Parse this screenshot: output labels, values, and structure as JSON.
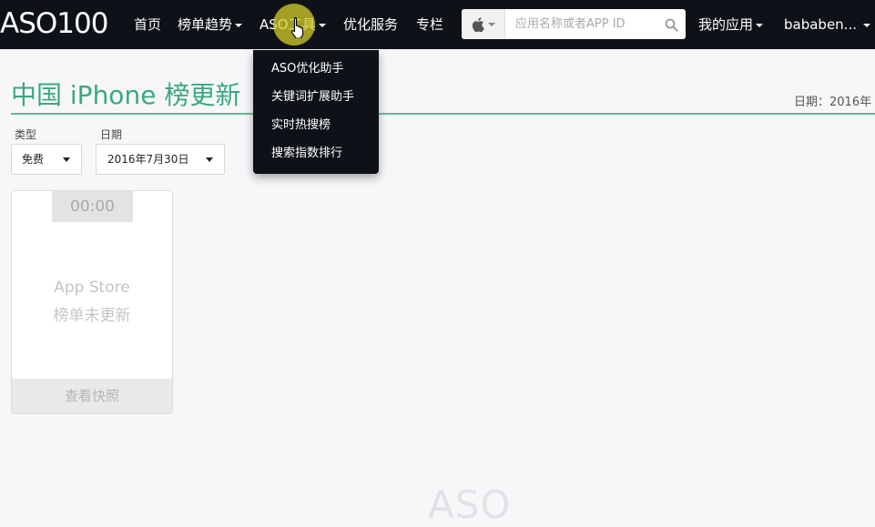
{
  "navbar": {
    "logo": "ASO100",
    "items": [
      {
        "label": "首页",
        "has_caret": false
      },
      {
        "label": "榜单趋势",
        "has_caret": true
      },
      {
        "label": "ASO工具",
        "has_caret": true
      },
      {
        "label": "优化服务",
        "has_caret": false
      },
      {
        "label": "专栏",
        "has_caret": false
      }
    ],
    "search": {
      "platform_icon": "apple-icon",
      "placeholder": "应用名称或者APP ID",
      "button_icon": "search-icon"
    },
    "my_apps": "我的应用",
    "user": "bababen..."
  },
  "tools_dropdown": {
    "items": [
      "ASO优化助手",
      "关键词扩展助手",
      "实时热搜榜",
      "搜索指数排行"
    ]
  },
  "page": {
    "title": "中国 iPhone 榜更新",
    "date_label": "日期：2016年"
  },
  "filters": {
    "type_label": "类型",
    "type_value": "免费",
    "date_label": "日期",
    "date_value": "2016年7月30日"
  },
  "card": {
    "timer": "00:00",
    "line1": "App Store",
    "line2": "榜单未更新",
    "footer": "查看快照"
  },
  "watermark": "ASO",
  "colors": {
    "navbar_bg": "#0e1218",
    "accent_green": "#3aa87e",
    "cursor_highlight": "#d6ce28"
  }
}
